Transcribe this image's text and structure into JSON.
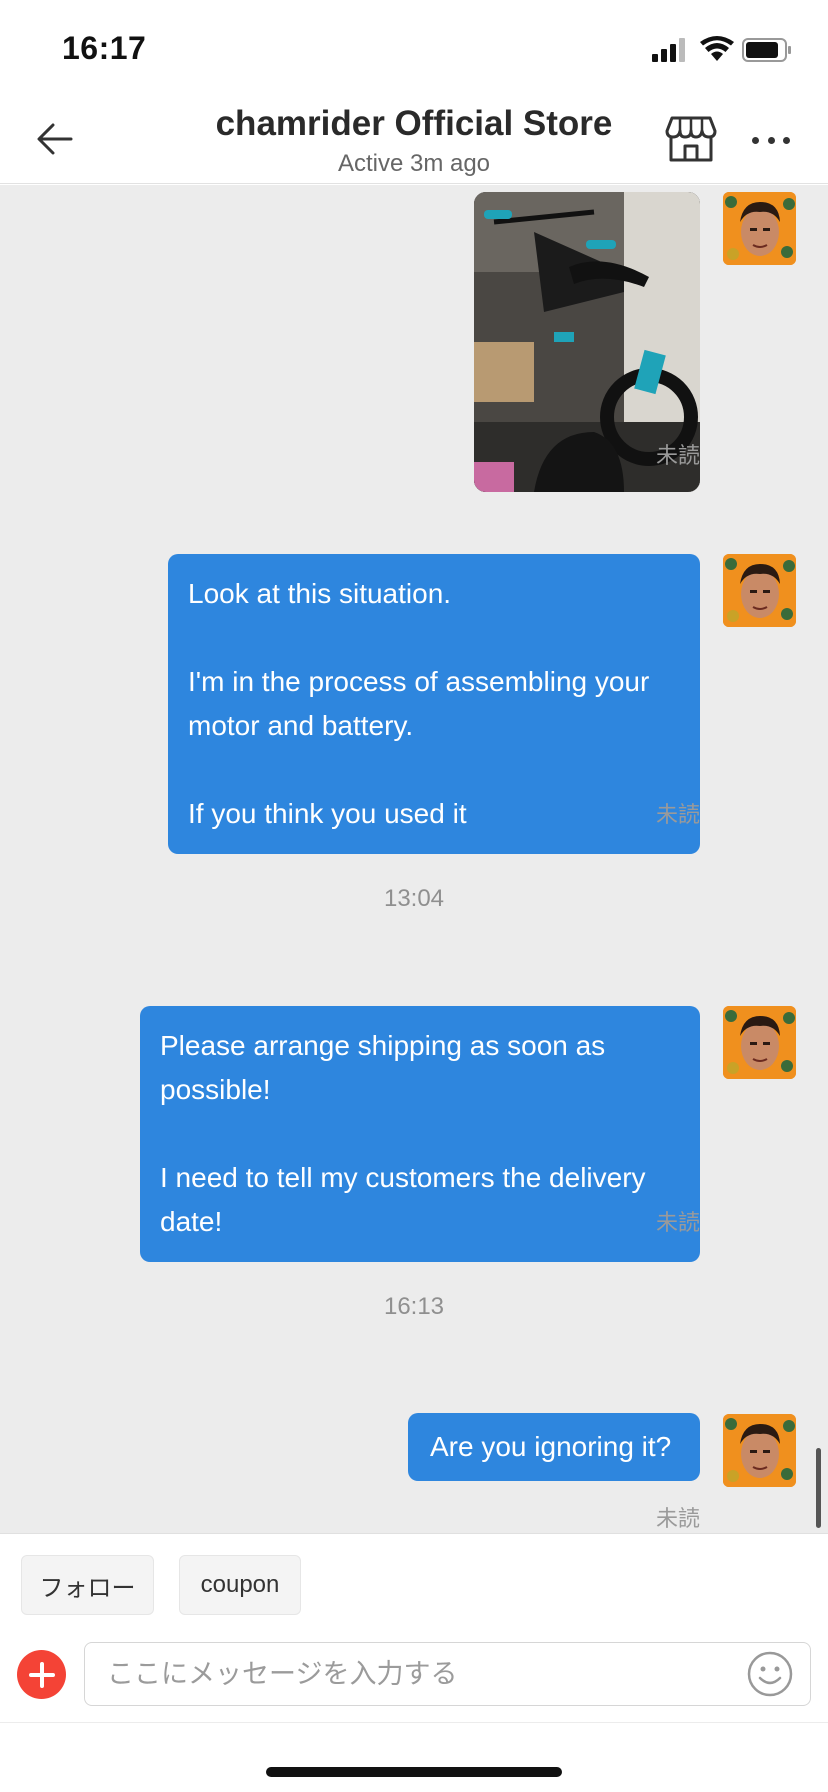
{
  "status_bar": {
    "time": "16:17"
  },
  "header": {
    "title": "chamrider Official Store",
    "subtitle": "Active 3m ago"
  },
  "messages": [
    {
      "type": "image",
      "status": "未読"
    },
    {
      "type": "text",
      "text": "Look at this situation.\n\nI'm in the process of assembling your motor and battery.\n\nIf you think you used it",
      "status": "未読"
    },
    {
      "type": "timestamp",
      "text": "13:04"
    },
    {
      "type": "text",
      "text": "Please arrange shipping as soon as possible!\n\nI need to tell my customers the delivery date!",
      "status": "未読"
    },
    {
      "type": "timestamp",
      "text": "16:13"
    },
    {
      "type": "text",
      "text": "Are you ignoring it?",
      "status": "未読"
    }
  ],
  "quick_replies": [
    "フォロー",
    "coupon"
  ],
  "composer": {
    "placeholder": "ここにメッセージを入力する"
  },
  "icons": {
    "back": "back-arrow-icon",
    "store": "store-icon",
    "more": "more-dots-icon",
    "add": "plus-icon",
    "emoji": "smiley-icon"
  },
  "colors": {
    "bubble": "#2e86de",
    "chat_background": "#ececec",
    "add_button": "#f44336"
  }
}
